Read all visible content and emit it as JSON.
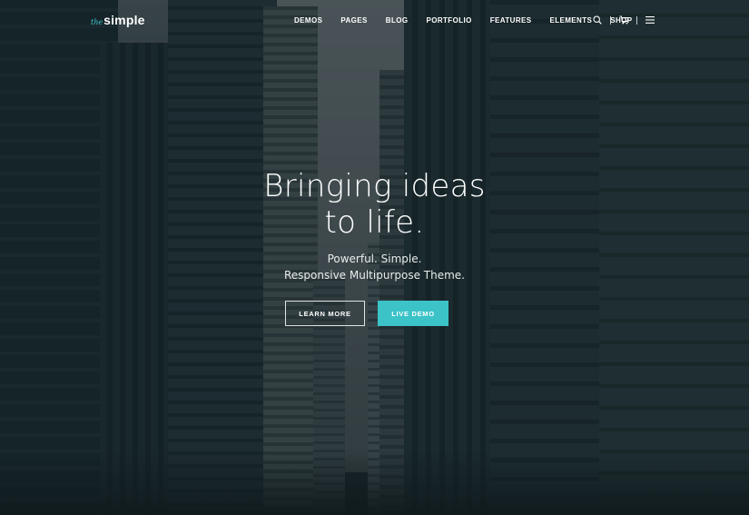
{
  "logo": {
    "prefix": "the",
    "name": "simple"
  },
  "nav": {
    "items": [
      {
        "label": "DEMOS"
      },
      {
        "label": "PAGES"
      },
      {
        "label": "BLOG"
      },
      {
        "label": "PORTFOLIO"
      },
      {
        "label": "FEATURES"
      },
      {
        "label": "ELEMENTS"
      },
      {
        "label": "SHOP"
      }
    ],
    "icons": [
      "search-icon",
      "cart-icon",
      "menu-icon"
    ]
  },
  "hero": {
    "title_line1": "Bringing ideas",
    "title_line2": "to life.",
    "subtitle_line1": "Powerful. Simple.",
    "subtitle_line2": "Responsive Multipurpose Theme.",
    "primary_button": "LEARN MORE",
    "secondary_button": "LIVE DEMO"
  },
  "colors": {
    "accent": "#3bc3c8",
    "overlay": "#0e1c22"
  }
}
